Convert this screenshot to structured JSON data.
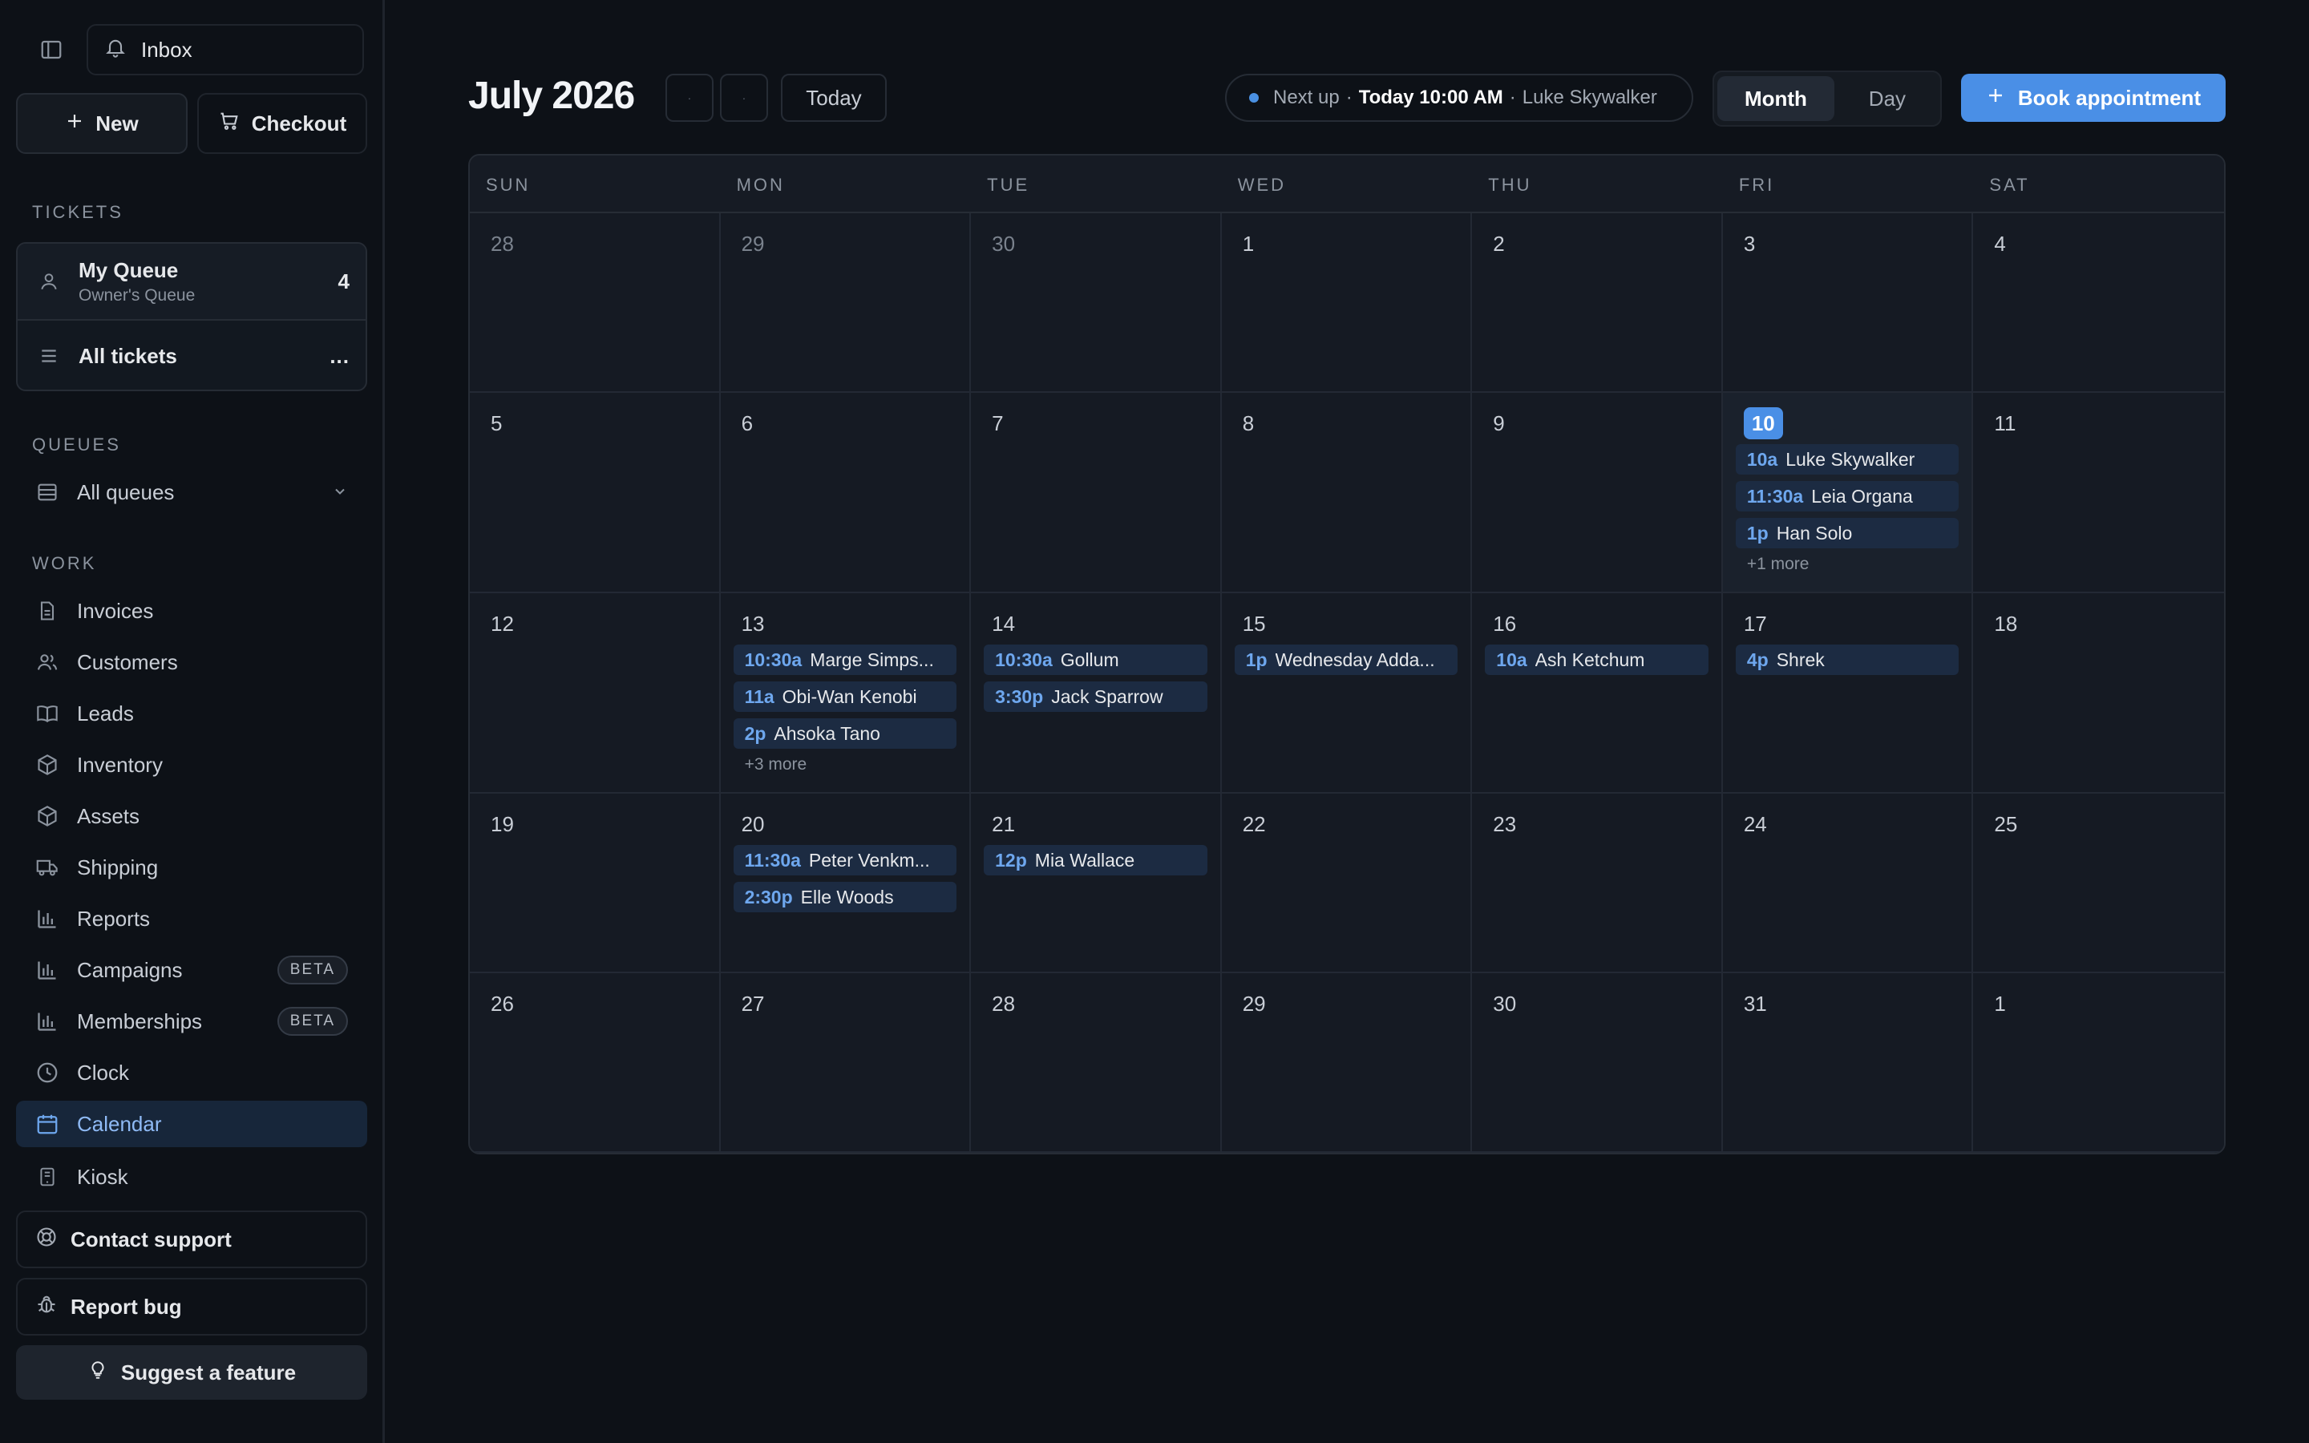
{
  "sidebar": {
    "inbox_label": "Inbox",
    "new_label": "New",
    "checkout_label": "Checkout",
    "tickets_section": "TICKETS",
    "my_queue": {
      "title": "My Queue",
      "subtitle": "Owner's Queue",
      "count": "4"
    },
    "all_tickets": {
      "title": "All tickets",
      "more": "..."
    },
    "queues_section": "QUEUES",
    "all_queues_label": "All queues",
    "work_section": "WORK",
    "items": [
      {
        "label": "Invoices",
        "icon": "file-icon"
      },
      {
        "label": "Customers",
        "icon": "users-icon"
      },
      {
        "label": "Leads",
        "icon": "book-icon"
      },
      {
        "label": "Inventory",
        "icon": "box-icon"
      },
      {
        "label": "Assets",
        "icon": "box-icon"
      },
      {
        "label": "Shipping",
        "icon": "truck-icon"
      },
      {
        "label": "Reports",
        "icon": "bar-chart-icon"
      },
      {
        "label": "Campaigns",
        "icon": "bar-chart-icon",
        "badge": "BETA"
      },
      {
        "label": "Memberships",
        "icon": "bar-chart-icon",
        "badge": "BETA"
      },
      {
        "label": "Clock",
        "icon": "clock-icon"
      },
      {
        "label": "Calendar",
        "icon": "calendar-icon",
        "active": true
      },
      {
        "label": "Kiosk",
        "icon": "tablet-icon"
      }
    ],
    "contact_support": "Contact support",
    "report_bug": "Report bug",
    "suggest_feature": "Suggest a feature"
  },
  "header": {
    "title": "July 2026",
    "today_label": "Today",
    "next_up": {
      "prefix": "Next up",
      "time": "Today 10:00 AM",
      "name": "Luke Skywalker"
    },
    "view_month": "Month",
    "view_day": "Day",
    "book_label": "Book appointment"
  },
  "colors": {
    "accent": "#4a8fe6",
    "event_bg": "#1c2b42",
    "event_time": "#6ea7ee"
  },
  "calendar": {
    "weekdays": [
      "SUN",
      "MON",
      "TUE",
      "WED",
      "THU",
      "FRI",
      "SAT"
    ],
    "weeks": [
      [
        {
          "d": "28",
          "muted": true
        },
        {
          "d": "29",
          "muted": true
        },
        {
          "d": "30",
          "muted": true
        },
        {
          "d": "1"
        },
        {
          "d": "2"
        },
        {
          "d": "3"
        },
        {
          "d": "4"
        }
      ],
      [
        {
          "d": "5"
        },
        {
          "d": "6"
        },
        {
          "d": "7"
        },
        {
          "d": "8"
        },
        {
          "d": "9"
        },
        {
          "d": "10",
          "today": true,
          "events": [
            {
              "t": "10a",
              "n": "Luke Skywalker"
            },
            {
              "t": "11:30a",
              "n": "Leia Organa"
            },
            {
              "t": "1p",
              "n": "Han Solo"
            }
          ],
          "more": "+1 more"
        },
        {
          "d": "11"
        }
      ],
      [
        {
          "d": "12"
        },
        {
          "d": "13",
          "events": [
            {
              "t": "10:30a",
              "n": "Marge Simps..."
            },
            {
              "t": "11a",
              "n": "Obi-Wan Kenobi"
            },
            {
              "t": "2p",
              "n": "Ahsoka Tano"
            }
          ],
          "more": "+3 more"
        },
        {
          "d": "14",
          "events": [
            {
              "t": "10:30a",
              "n": "Gollum"
            },
            {
              "t": "3:30p",
              "n": "Jack Sparrow"
            }
          ]
        },
        {
          "d": "15",
          "events": [
            {
              "t": "1p",
              "n": "Wednesday Adda..."
            }
          ]
        },
        {
          "d": "16",
          "events": [
            {
              "t": "10a",
              "n": "Ash Ketchum"
            }
          ]
        },
        {
          "d": "17",
          "events": [
            {
              "t": "4p",
              "n": "Shrek"
            }
          ]
        },
        {
          "d": "18"
        }
      ],
      [
        {
          "d": "19"
        },
        {
          "d": "20",
          "events": [
            {
              "t": "11:30a",
              "n": "Peter Venkm..."
            },
            {
              "t": "2:30p",
              "n": "Elle Woods"
            }
          ]
        },
        {
          "d": "21",
          "events": [
            {
              "t": "12p",
              "n": "Mia Wallace"
            }
          ]
        },
        {
          "d": "22"
        },
        {
          "d": "23"
        },
        {
          "d": "24"
        },
        {
          "d": "25"
        }
      ],
      [
        {
          "d": "26"
        },
        {
          "d": "27"
        },
        {
          "d": "28"
        },
        {
          "d": "29"
        },
        {
          "d": "30"
        },
        {
          "d": "31"
        },
        {
          "d": "1"
        }
      ]
    ]
  }
}
